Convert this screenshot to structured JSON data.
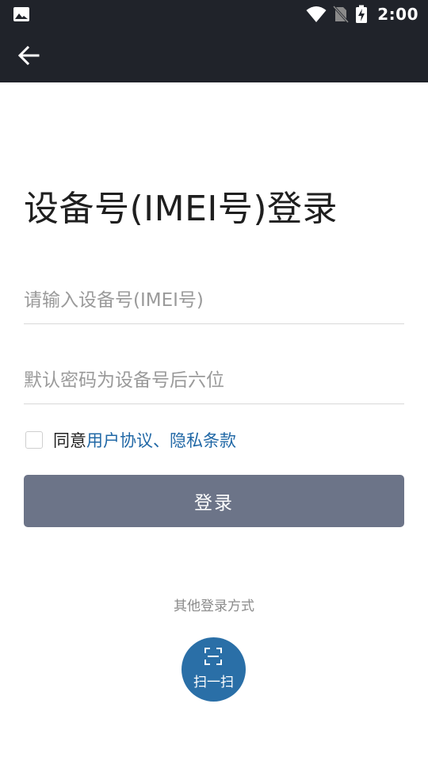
{
  "status_bar": {
    "time": "2:00",
    "icons": [
      "image-icon",
      "wifi-icon",
      "no-sim-icon",
      "battery-charging-icon"
    ]
  },
  "app_bar": {
    "back_icon": "arrow-left-icon"
  },
  "page": {
    "title": "设备号(IMEI号)登录"
  },
  "form": {
    "imei_placeholder": "请输入设备号(IMEI号)",
    "imei_value": "",
    "password_placeholder": "默认密码为设备号后六位",
    "password_value": "",
    "agree_prefix": "同意",
    "agree_link": "用户协议、隐私条款",
    "agree_checked": false,
    "login_label": "登录"
  },
  "other_login": {
    "label": "其他登录方式",
    "scan_label": "扫一扫",
    "scan_icon": "scan-icon"
  },
  "colors": {
    "bar_bg": "#20232a",
    "button_bg": "#6c7488",
    "link": "#2168a6",
    "scan_bg": "#2a6fa7"
  }
}
